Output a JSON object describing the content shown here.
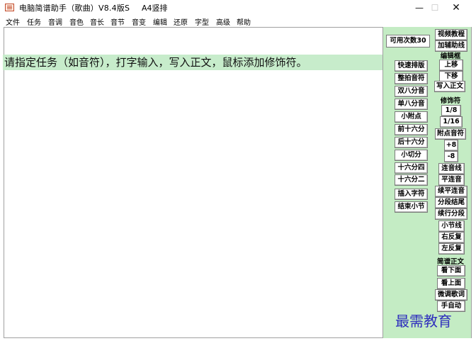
{
  "window": {
    "title": "电脑简谱助手（歌曲）V8.4版S",
    "paper": "A4竖排",
    "controls": {
      "minimize": "—",
      "maximize": "☐",
      "close": "✕"
    }
  },
  "menu": [
    "文件",
    "任务",
    "音调",
    "音色",
    "音长",
    "音节",
    "音变",
    "编辑",
    "还原",
    "字型",
    "高级",
    "帮助"
  ],
  "instruction": "请指定任务（如音符），打字输入，写入正文，鼠标添加修饰符。",
  "panel": {
    "uses_left": "可用次数30",
    "col1": [
      "快速排版",
      "整拍音符",
      "双八分音",
      "单八分音",
      "小附点",
      "前十六分",
      "后十六分",
      "小切分",
      "十六分四",
      "十六分二",
      "插入字符",
      "结束小节"
    ],
    "col2_top": [
      "视频教程",
      "加辅助线"
    ],
    "edit_box_label": "编辑框",
    "move_up": "上移",
    "move_down": "下移",
    "write_text": "写入正文",
    "modifier_label": "修饰符",
    "eighth": "1/8",
    "sixteenth": "1/16",
    "dotted": "附点音符",
    "plus8": "+8",
    "minus8": "-8",
    "col2_bottom": [
      "连音线",
      "平连音",
      "续平连音",
      "分段结尾",
      "续行分段",
      "小节线",
      "右反复",
      "左反复"
    ],
    "score_text_label": "简谱正文",
    "view_down": "看下面",
    "view_up": "看上面",
    "fine_tune": "微调歌词",
    "manual_auto": "手自动"
  },
  "watermark": "最需教育",
  "colors": {
    "panel_bg": "#c4ecc4",
    "instruction_bg": "#c7eccb",
    "watermark": "#2f2fbd"
  }
}
